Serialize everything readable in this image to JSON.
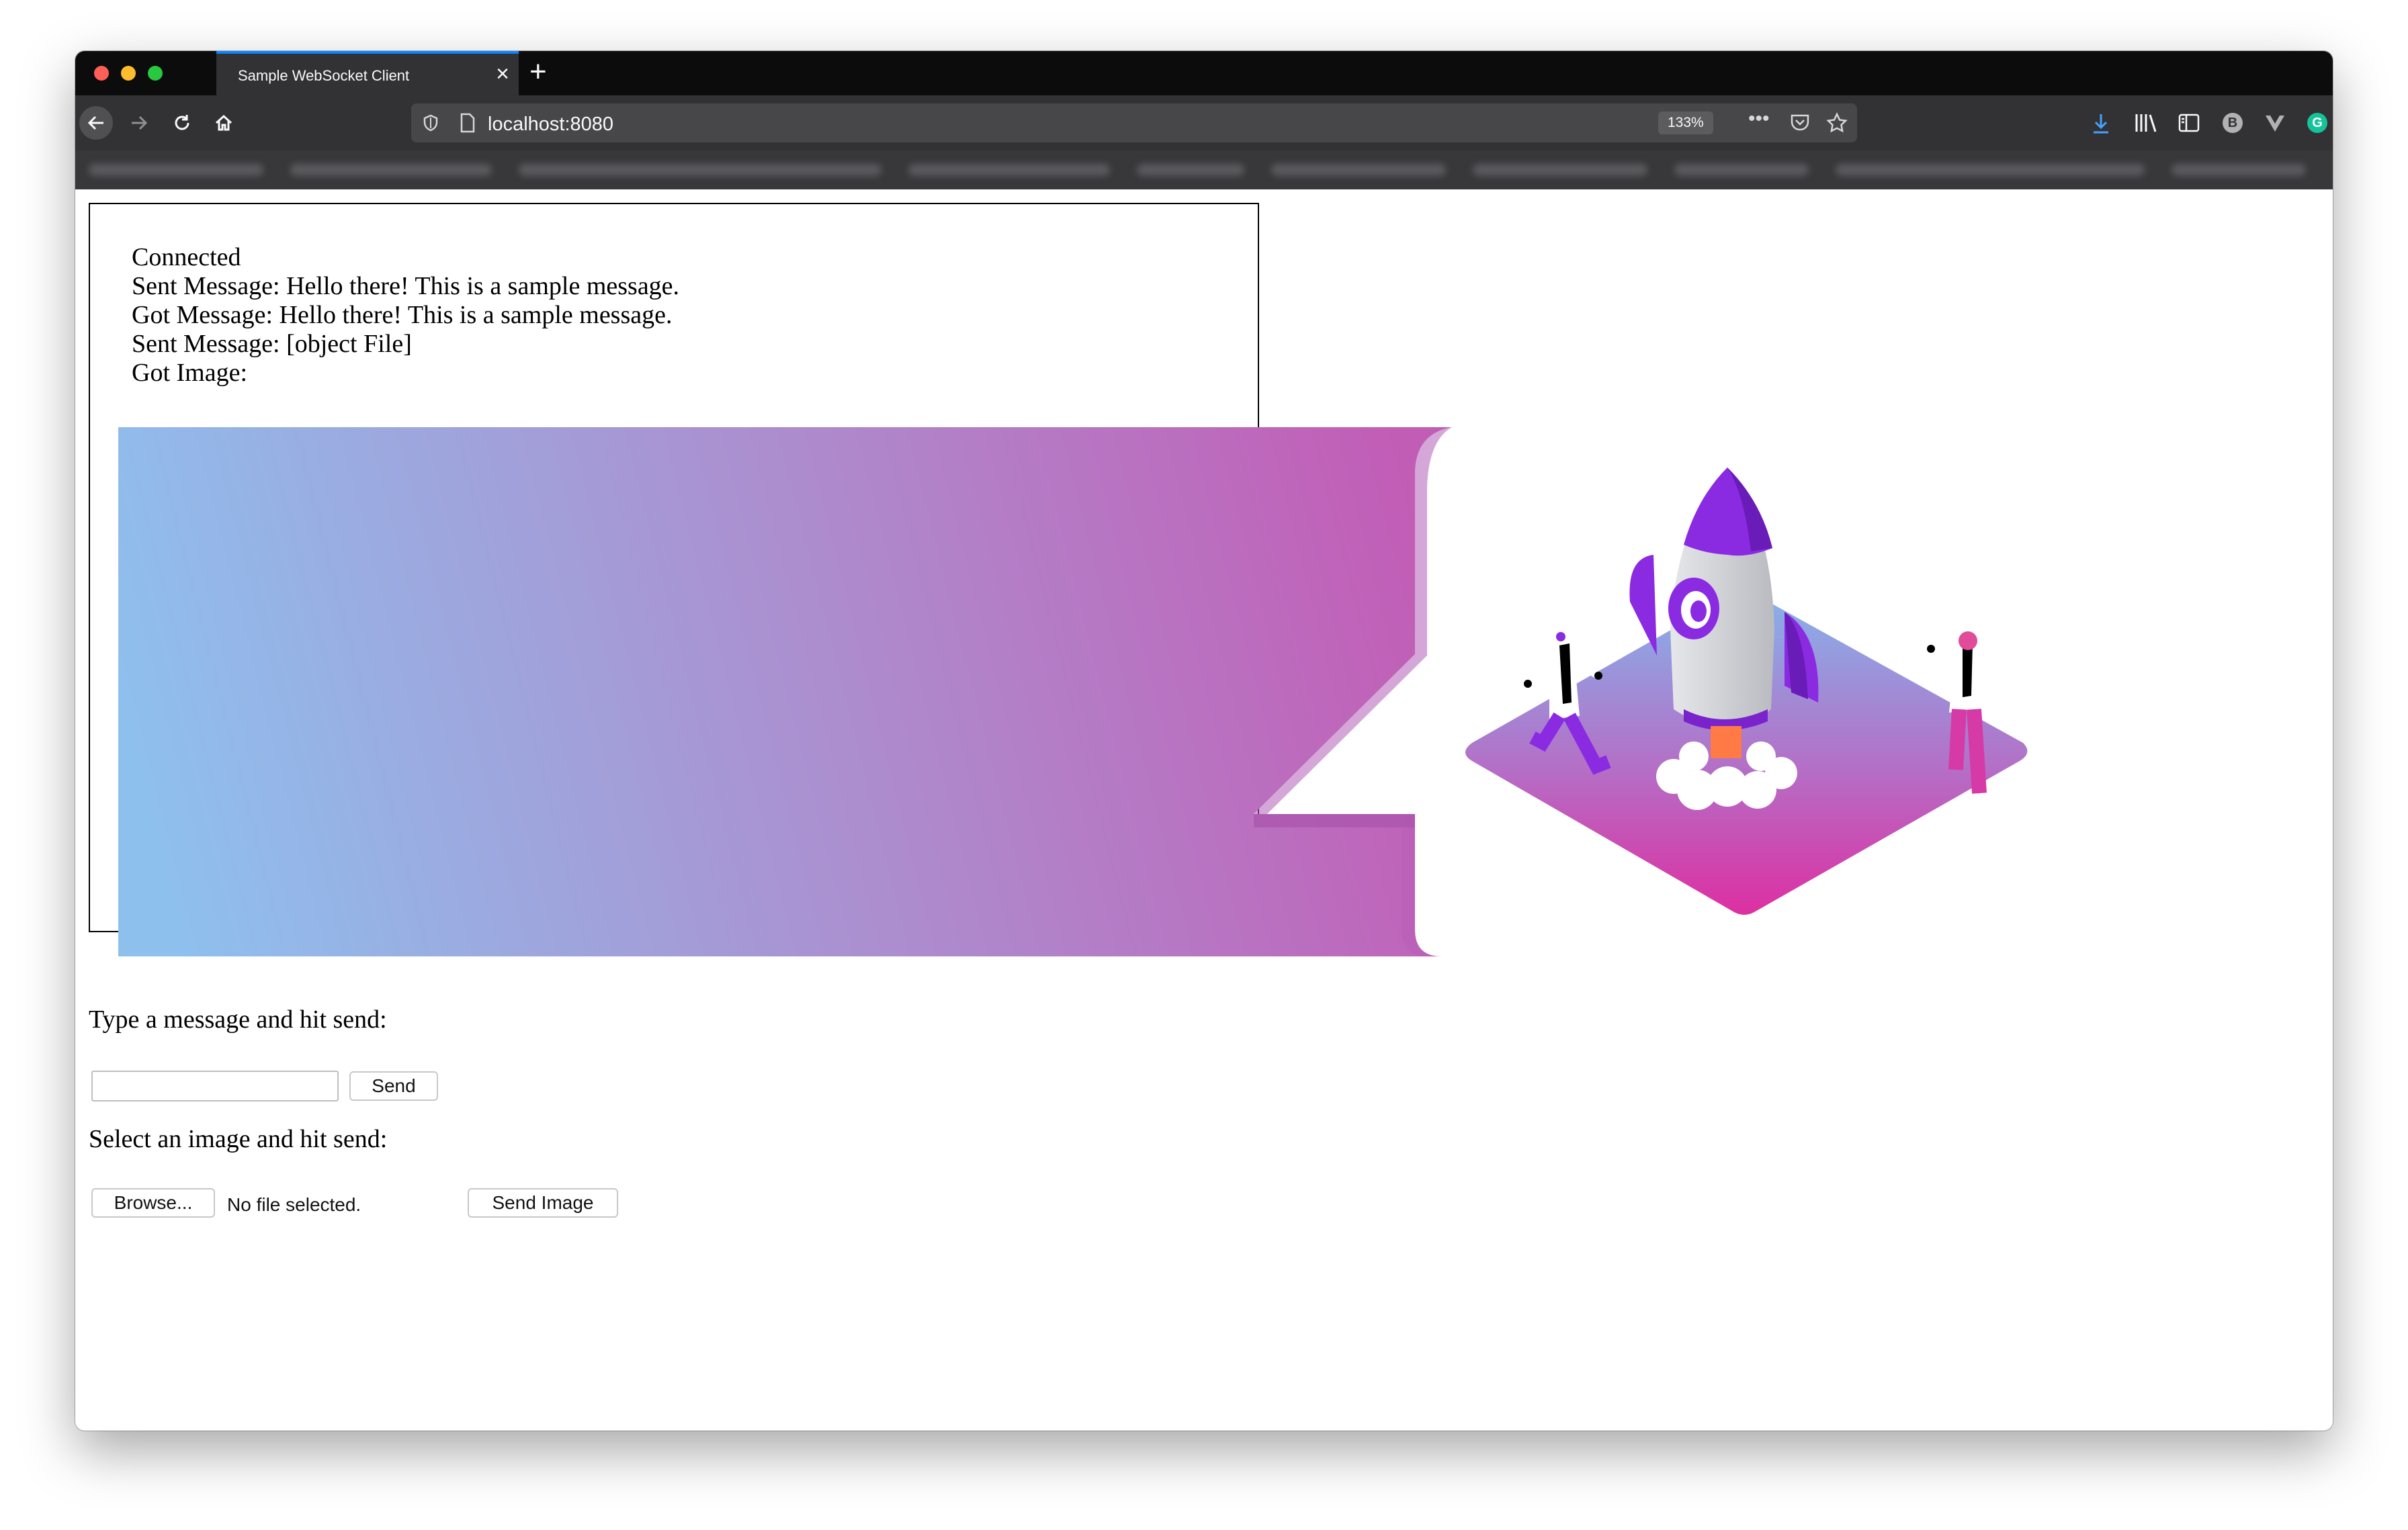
{
  "browser": {
    "tab_title": "Sample WebSocket Client",
    "url": "localhost:8080",
    "zoom": "133%"
  },
  "log": {
    "lines": [
      "Connected",
      "Sent Message: Hello there! This is a sample message.",
      "Got Message: Hello there! This is a sample message.",
      "Sent Message: [object File]",
      "Got Image:"
    ]
  },
  "message_form": {
    "label": "Type a message and hit send:",
    "input_value": "",
    "send_label": "Send"
  },
  "image_form": {
    "label": "Select an image and hit send:",
    "browse_label": "Browse...",
    "file_status": "No file selected.",
    "send_label": "Send Image"
  },
  "colors": {
    "gradient_left": "#8ec0ee",
    "gradient_right": "#c25db6",
    "rocket_purple": "#8a2be2",
    "platform_pink": "#d63aa6"
  }
}
